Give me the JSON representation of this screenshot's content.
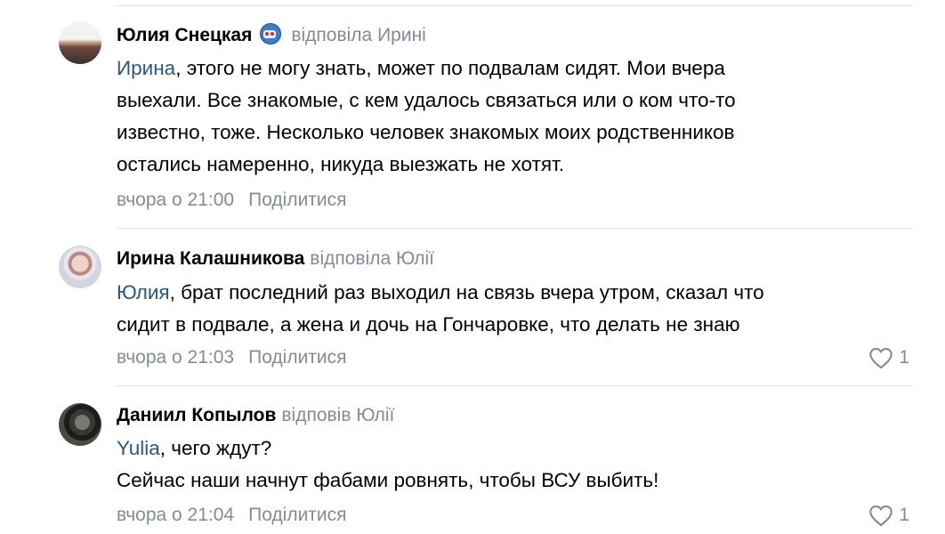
{
  "comments": [
    {
      "author": "Юлия Снецкая",
      "badge_icon": "hero-mask-badge-icon",
      "reply_to": "відповіла Ирині",
      "mention": "Ирина",
      "lines": [
        ", этого не могу знать, может по подвалам сидят. Мои вчера",
        "выехали. Все знакомые, с кем удалось связаться или о ком что-то",
        "известно, тоже. Несколько человек знакомых моих родственников",
        "остались намеренно, никуда выезжать не хотят."
      ],
      "time": "вчора о 21:00",
      "share": "Поділитися"
    },
    {
      "author": "Ирина Калашникова",
      "reply_to": "відповіла Юлії",
      "mention": "Юлия",
      "lines": [
        ", брат последний раз выходил на связь вчера утром, сказал что",
        "сидит в подвале, а жена и дочь на Гончаровке, что делать не знаю"
      ],
      "time": "вчора о 21:03",
      "share": "Поділитися",
      "likes": "1"
    },
    {
      "author": "Даниил Копылов",
      "reply_to": "відповів Юлії",
      "mention": "Yulia",
      "lines": [
        ", чего ждут?",
        "Сейчас наши начнут фабами ровнять, чтобы ВСУ выбить!"
      ],
      "time": "вчора о 21:04",
      "share": "Поділитися",
      "likes": "1"
    }
  ],
  "colors": {
    "author": "#000000",
    "muted": "#818c99",
    "mention": "#2a5885",
    "separator": "#e3e5e8"
  }
}
